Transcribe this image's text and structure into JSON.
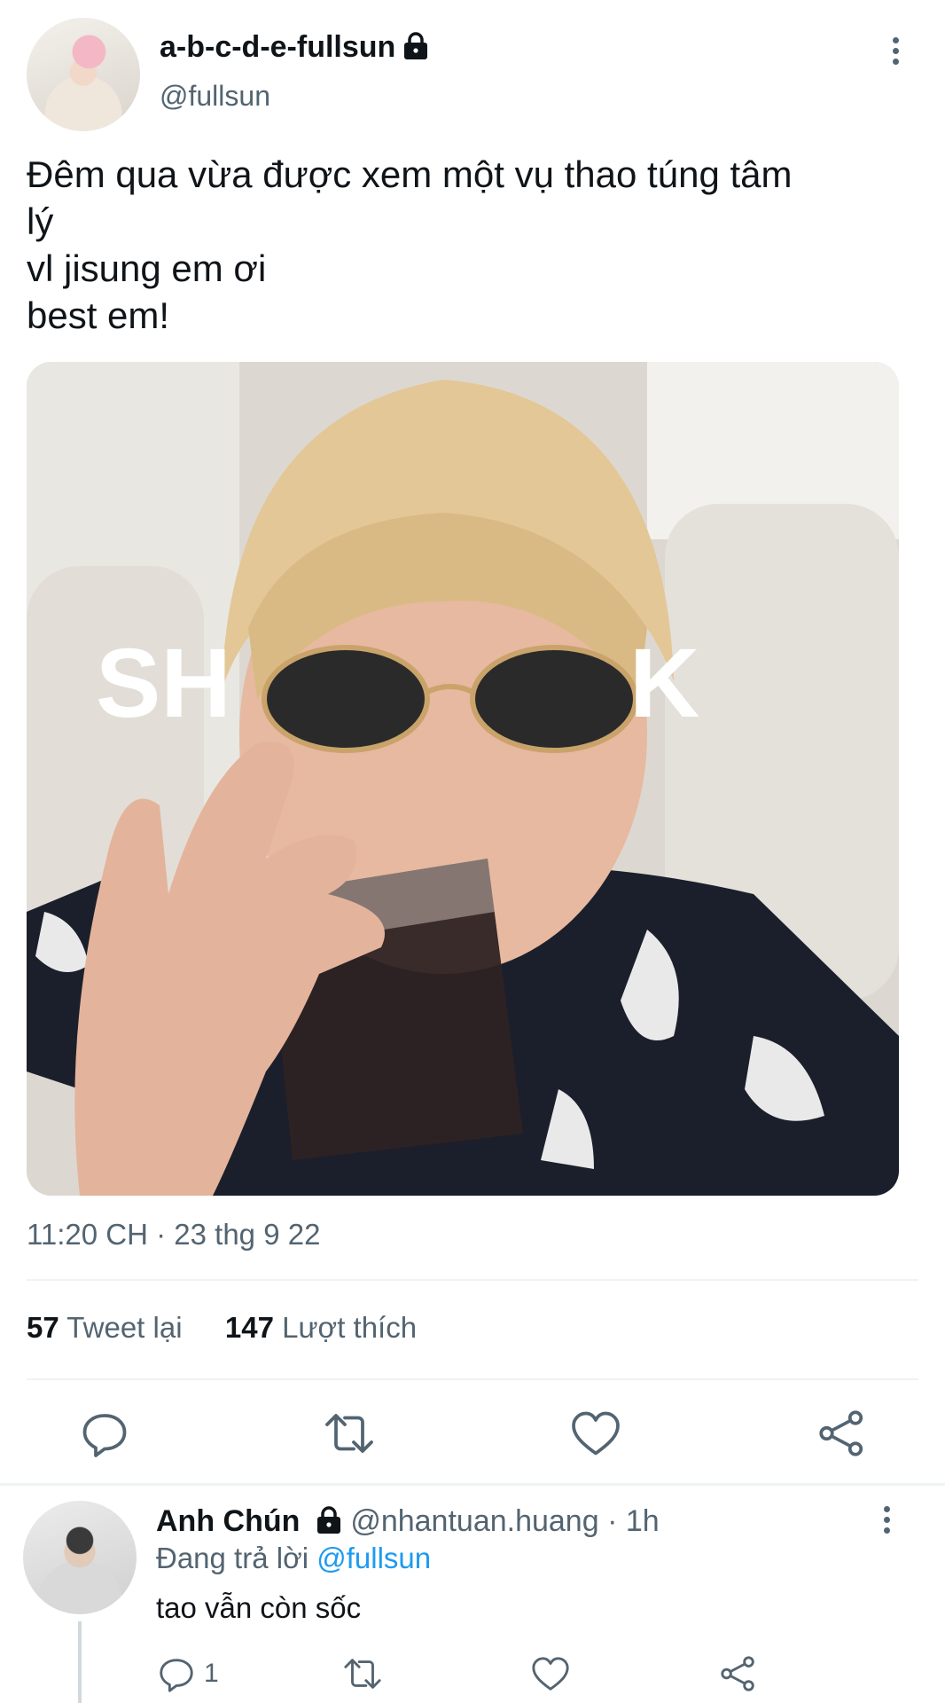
{
  "tweet": {
    "display_name": "a-b-c-d-e-fullsun",
    "handle": "@fullsun",
    "text": "Đêm qua vừa được xem một vụ thao túng tâm\nlý\nvl jisung em ơi\nbest em!",
    "image": {
      "overlay_left": "SH",
      "overlay_right": "K"
    },
    "timestamp": "11:20 CH · 23 thg 9 22",
    "stats": {
      "retweets_count": "57",
      "retweets_label": "Tweet lại",
      "likes_count": "147",
      "likes_label": "Lượt thích"
    },
    "actions": [
      "reply-icon",
      "retweet-icon",
      "like-icon",
      "share-icon"
    ]
  },
  "reply": {
    "display_name": "Anh Chún",
    "handle_time": "@nhantuan.huang · 1h",
    "replying_prefix": "Đang trả lời",
    "replying_to": "@fullsun",
    "text": "tao vẫn còn sốc",
    "reply_count": "1"
  },
  "colors": {
    "text_primary": "#0f1419",
    "text_secondary": "#536471",
    "link": "#1d9bf0",
    "divider": "#eff3f4"
  }
}
